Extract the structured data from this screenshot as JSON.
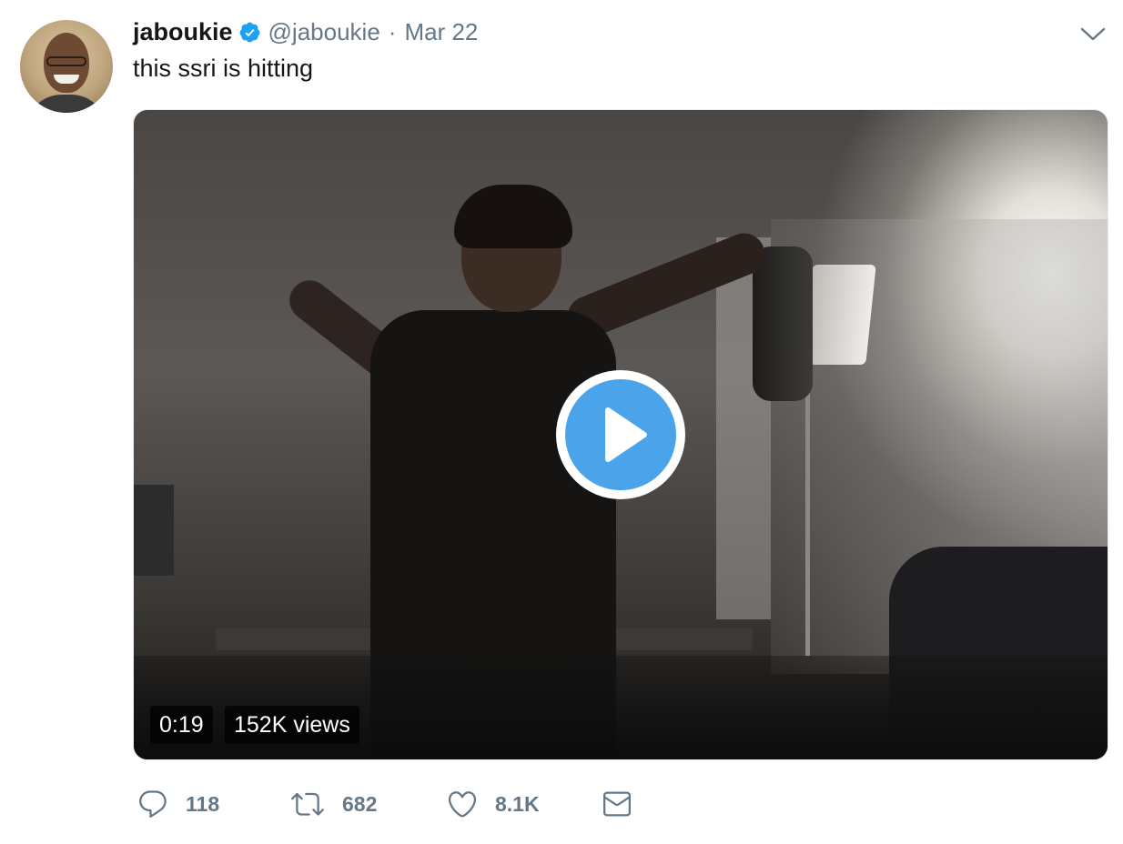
{
  "tweet": {
    "display_name": "jaboukie",
    "handle": "@jaboukie",
    "separator": "·",
    "date": "Mar 22",
    "text": "this ssri is hitting",
    "verified": true
  },
  "media": {
    "type": "video",
    "duration": "0:19",
    "views": "152K views",
    "play_icon": "play-icon"
  },
  "actions": {
    "reply": {
      "icon": "reply-icon",
      "count": "118"
    },
    "retweet": {
      "icon": "retweet-icon",
      "count": "682"
    },
    "like": {
      "icon": "heart-icon",
      "count": "8.1K"
    },
    "message": {
      "icon": "envelope-icon"
    }
  },
  "colors": {
    "verified_blue": "#1da1f2",
    "play_blue": "#4ba3ea",
    "secondary_text": "#657786",
    "primary_text": "#14171a"
  }
}
